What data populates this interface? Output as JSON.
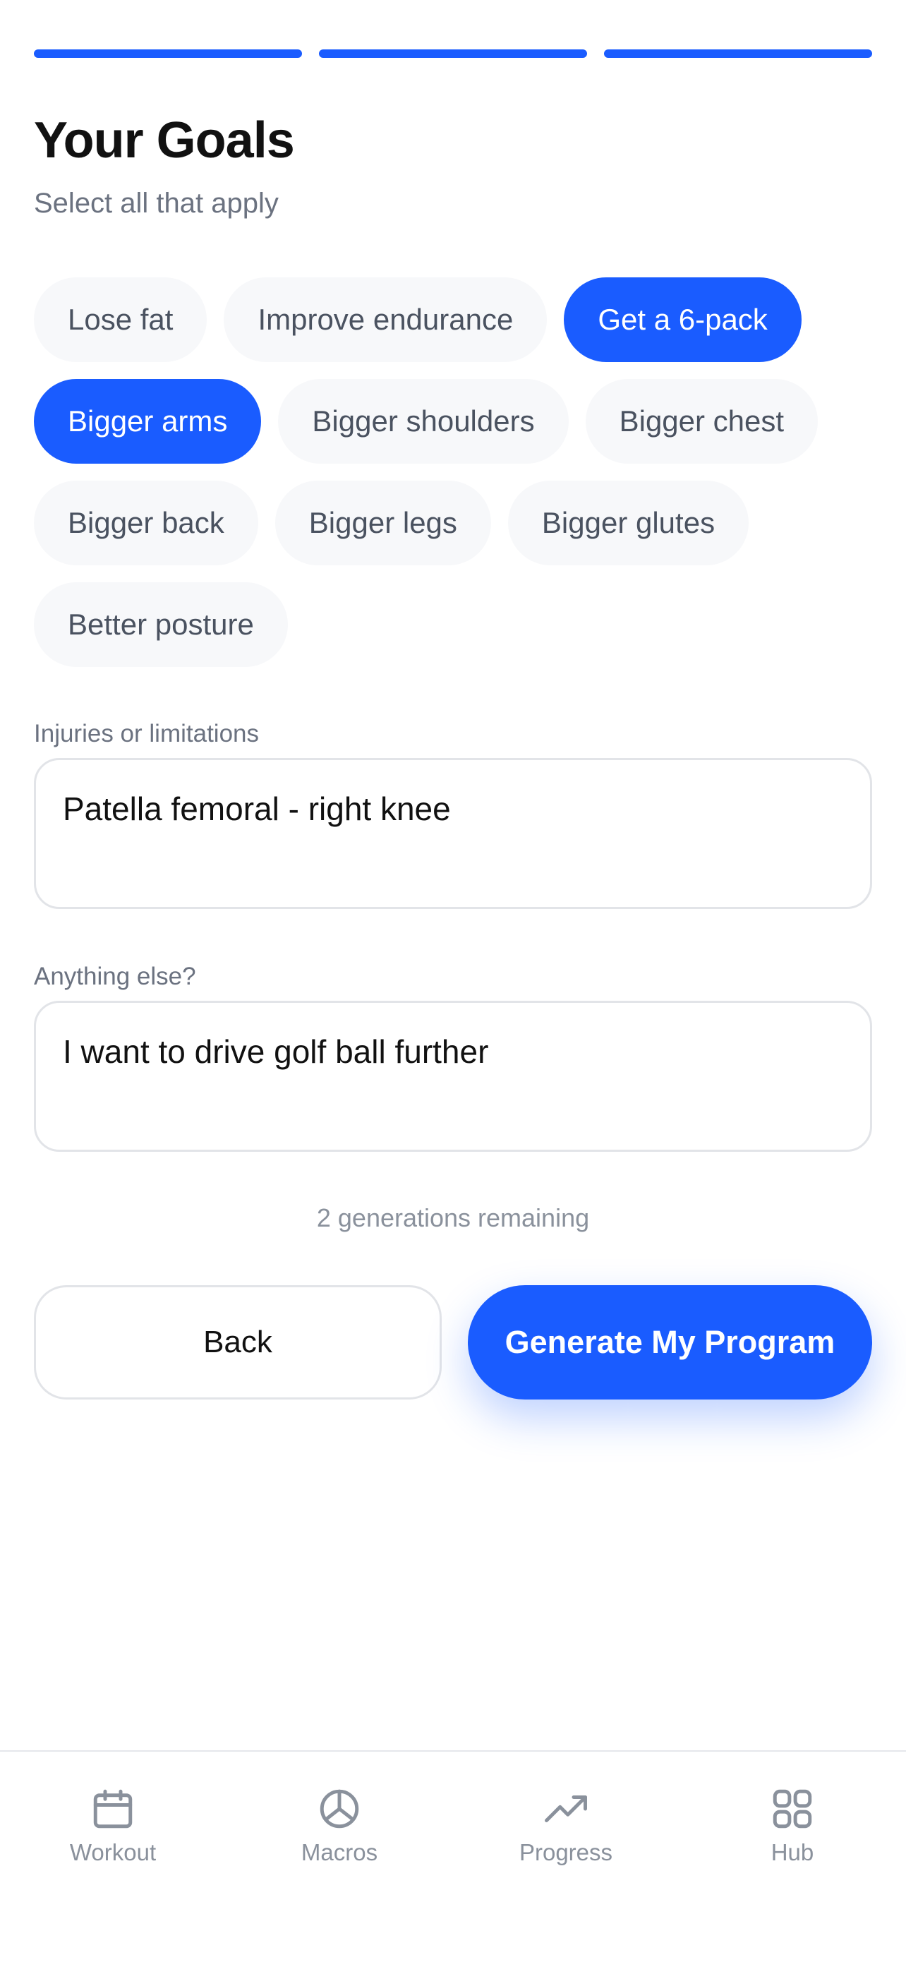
{
  "header": {
    "title": "Your Goals",
    "subtitle": "Select all that apply"
  },
  "goals": [
    {
      "label": "Lose fat",
      "selected": false
    },
    {
      "label": "Improve endurance",
      "selected": false
    },
    {
      "label": "Get a 6-pack",
      "selected": true
    },
    {
      "label": "Bigger arms",
      "selected": true
    },
    {
      "label": "Bigger shoulders",
      "selected": false
    },
    {
      "label": "Bigger chest",
      "selected": false
    },
    {
      "label": "Bigger back",
      "selected": false
    },
    {
      "label": "Bigger legs",
      "selected": false
    },
    {
      "label": "Bigger glutes",
      "selected": false
    },
    {
      "label": "Better posture",
      "selected": false
    }
  ],
  "injuries": {
    "label": "Injuries or limitations",
    "value": "Patella femoral - right knee"
  },
  "extra": {
    "label": "Anything else?",
    "value": "I want to drive golf ball further"
  },
  "remaining_text": "2 generations remaining",
  "buttons": {
    "back": "Back",
    "generate": "Generate My Program"
  },
  "tabbar": {
    "items": [
      {
        "label": "Workout",
        "icon": "calendar-icon"
      },
      {
        "label": "Macros",
        "icon": "pie-chart-icon"
      },
      {
        "label": "Progress",
        "icon": "trending-up-icon"
      },
      {
        "label": "Hub",
        "icon": "grid-icon"
      }
    ]
  },
  "colors": {
    "accent": "#1a5cff",
    "chip_bg": "#f7f8fa",
    "muted_text": "#6b7280"
  }
}
